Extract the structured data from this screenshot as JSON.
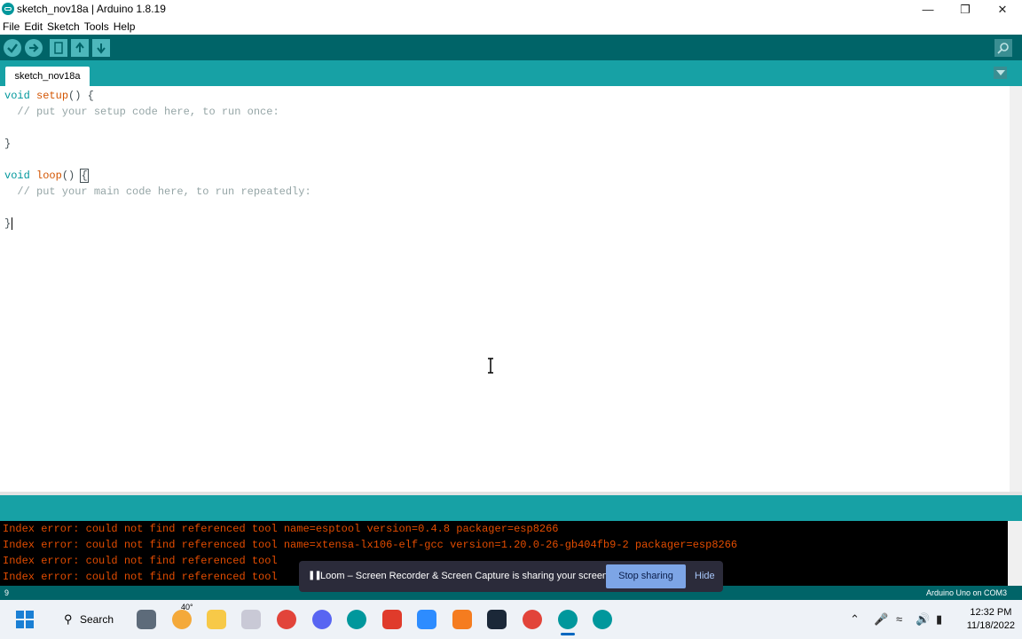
{
  "window": {
    "title": "sketch_nov18a | Arduino 1.8.19"
  },
  "menubar": {
    "items": [
      "File",
      "Edit",
      "Sketch",
      "Tools",
      "Help"
    ]
  },
  "toolbar": {
    "buttons": [
      "verify-icon",
      "upload-icon",
      "new-icon",
      "open-icon",
      "save-icon"
    ],
    "serial_monitor_icon": "magnifier-icon"
  },
  "tabs": {
    "active": "sketch_nov18a"
  },
  "editor": {
    "lines": [
      {
        "kw": "void",
        "fn": "setup",
        "rest": "() {"
      },
      {
        "comment": "  // put your setup code here, to run once:"
      },
      {
        "text": ""
      },
      {
        "text": "}"
      },
      {
        "text": ""
      },
      {
        "kw": "void",
        "fn": "loop",
        "rest1": "() ",
        "bracket": "{"
      },
      {
        "comment": "  // put your main code here, to run repeatedly:"
      },
      {
        "text": ""
      },
      {
        "text": "}"
      }
    ]
  },
  "console": {
    "lines": [
      "Index error: could not find referenced tool name=esptool version=0.4.8 packager=esp8266",
      "Index error: could not find referenced tool name=xtensa-lx106-elf-gcc version=1.20.0-26-gb404fb9-2 packager=esp8266",
      "Index error: could not find referenced tool",
      "Index error: could not find referenced tool"
    ]
  },
  "footer": {
    "line_number": "9",
    "board": "Arduino Uno on COM3"
  },
  "loom": {
    "message": "Loom – Screen Recorder & Screen Capture is sharing your screen.",
    "stop_label": "Stop sharing",
    "hide_label": "Hide"
  },
  "taskbar": {
    "search_label": "Search",
    "weather": "40°",
    "time": "12:32 PM",
    "date": "11/18/2022"
  },
  "colors": {
    "teal_dark": "#006468",
    "teal": "#17a1a5",
    "error": "#e34c00"
  }
}
